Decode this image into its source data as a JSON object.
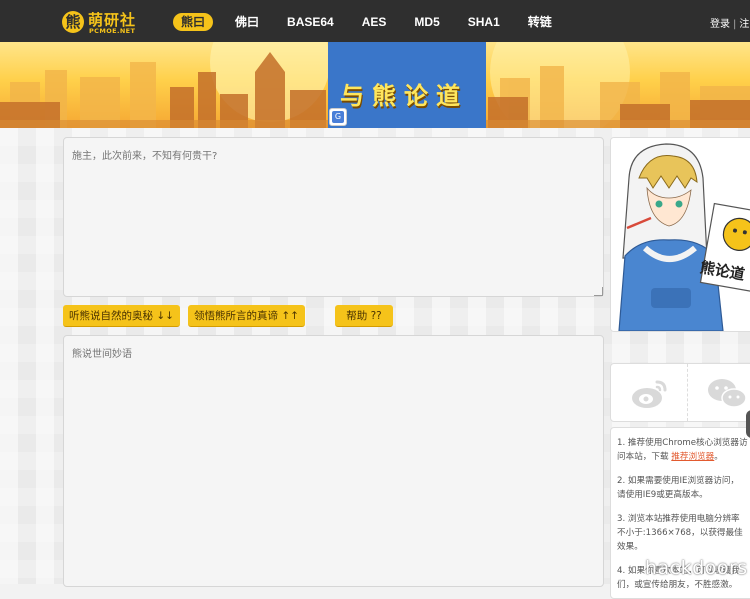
{
  "header": {
    "logo": {
      "mark": "熊",
      "title": "萌研社",
      "subtitle": "PCMOE.NET"
    },
    "nav": [
      {
        "label": "熊曰",
        "active": true
      },
      {
        "label": "佛曰",
        "active": false
      },
      {
        "label": "BASE64",
        "active": false
      },
      {
        "label": "AES",
        "active": false
      },
      {
        "label": "MD5",
        "active": false
      },
      {
        "label": "SHA1",
        "active": false
      },
      {
        "label": "转链",
        "active": false
      }
    ],
    "login": "登录",
    "separator": "|",
    "register": "注"
  },
  "banner": {
    "title": "与熊论道"
  },
  "editor": {
    "input_placeholder": "施主，此次前来，不知有何贵干?",
    "output_placeholder": "熊说世间妙语",
    "encode_button": "听熊说自然的奥秘 ↓↓",
    "decode_button": "领悟熊所言的真谛 ↑↑",
    "help_button": "帮助 ??"
  },
  "sidebar": {
    "mascot_sign": "熊论道",
    "tips": [
      {
        "lines": [
          "1. 推荐使用Chrome核心浏览器访",
          "问本站，下载 "
        ],
        "link": "推荐浏览器",
        "suffix": "。"
      },
      {
        "lines": [
          "2. 如果需要使用IE浏览器访问，",
          "请使用IE9或更高版本。"
        ]
      },
      {
        "lines": [
          "3. 浏览本站推荐使用电脑分辨率",
          "不小于:1366×768，以获得最佳",
          "效果。"
        ]
      },
      {
        "lines": [
          "4. 如果你喜欢本站，可以收藏我",
          "们，或宣传给朋友，不胜感激。"
        ]
      }
    ]
  },
  "watermark": "hackdoors",
  "colors": {
    "accent": "#f5c31a",
    "nav_bg": "#2f2f2f",
    "banner_blue": "#3a76c9",
    "link": "#e25a2f"
  }
}
